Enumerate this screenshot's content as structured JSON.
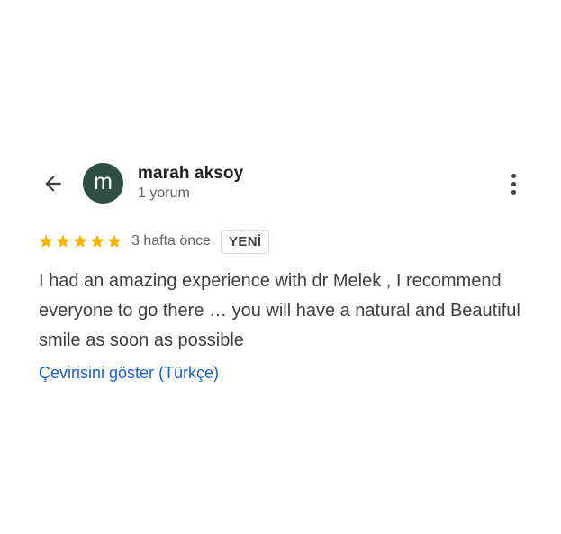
{
  "reviewer": {
    "avatar_letter": "m",
    "avatar_color": "#2f4f45",
    "name": "marah aksoy",
    "review_count": "1 yorum"
  },
  "review": {
    "rating": 5,
    "max_rating": 5,
    "star_color": "#f4b400",
    "time_ago": "3 hafta önce",
    "badge": "YENİ",
    "text": "I had an amazing experience with dr Melek , I recommend everyone to go there … you will have a natural and Beautiful smile as soon as possible",
    "translate_link": "Çevirisini göster (Türkçe)"
  },
  "icons": {
    "back": "arrow-back-icon",
    "more": "more-vert-icon",
    "star": "star-icon"
  }
}
